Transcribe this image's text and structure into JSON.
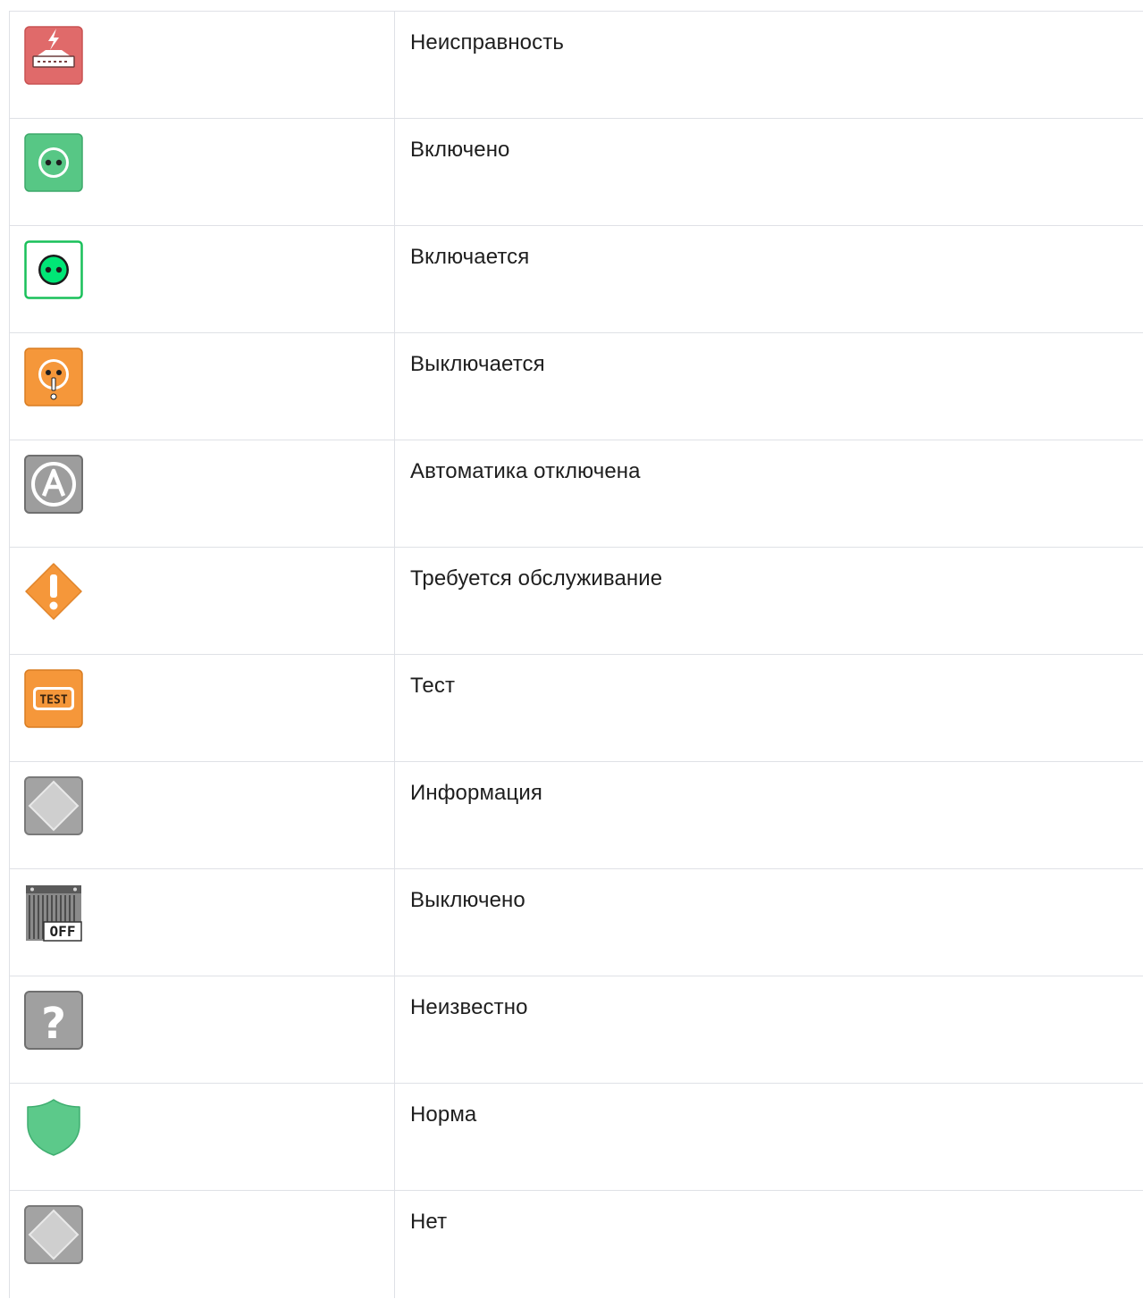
{
  "statuses": [
    {
      "icon": "fault-icon",
      "label": "Неисправность"
    },
    {
      "icon": "enabled-icon",
      "label": "Включено"
    },
    {
      "icon": "turning-on-icon",
      "label": "Включается"
    },
    {
      "icon": "turning-off-icon",
      "label": "Выключается"
    },
    {
      "icon": "automation-disabled-icon",
      "label": "Автоматика отключена"
    },
    {
      "icon": "maintenance-required-icon",
      "label": "Требуется обслуживание"
    },
    {
      "icon": "test-icon",
      "label": "Тест",
      "icon_text": "TEST"
    },
    {
      "icon": "information-icon",
      "label": "Информация"
    },
    {
      "icon": "disabled-off-icon",
      "label": "Выключено",
      "icon_text": "OFF"
    },
    {
      "icon": "unknown-icon",
      "label": "Неизвестно",
      "icon_text": "?"
    },
    {
      "icon": "normal-shield-icon",
      "label": "Норма"
    },
    {
      "icon": "none-icon",
      "label": "Нет"
    }
  ],
  "colors": {
    "fault_red": "#e06666",
    "enabled_green": "#57c785",
    "turning_on_green": "#00e676",
    "orange": "#f59b3c",
    "gray": "#a0a0a0",
    "border": "#dfe1e6"
  }
}
